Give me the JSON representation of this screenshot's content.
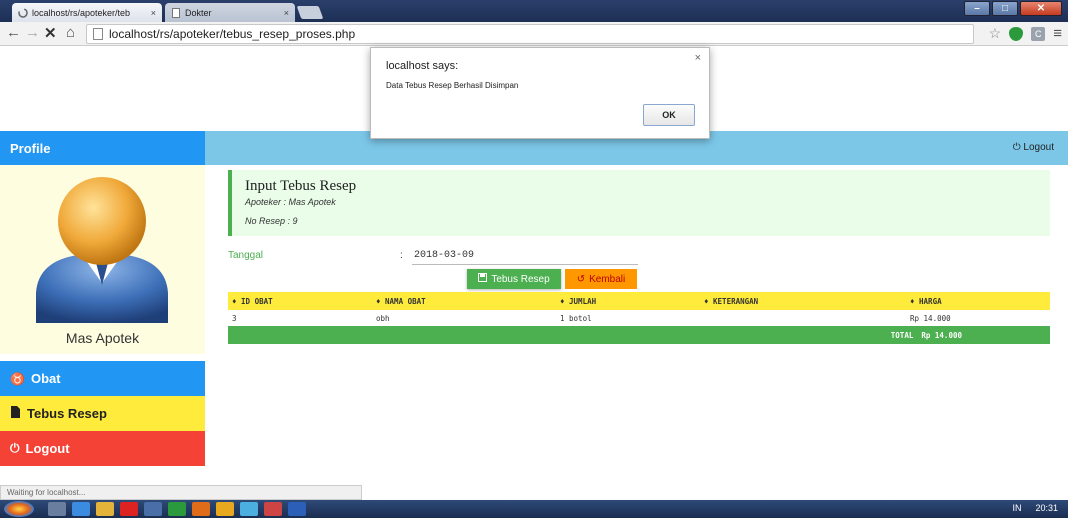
{
  "browser": {
    "tabs": [
      {
        "label": "localhost/rs/apoteker/teb",
        "close": "×"
      },
      {
        "label": "Dokter",
        "close": "×"
      }
    ],
    "url": "localhost/rs/apoteker/tebus_resep_proses.php",
    "status": "Waiting for localhost..."
  },
  "dialog": {
    "title": "localhost says:",
    "message": "Data Tebus Resep Berhasil Disimpan",
    "ok_label": "OK",
    "close": "×"
  },
  "sidebar": {
    "header": "Profile",
    "user_name": "Mas Apotek",
    "items": [
      {
        "label": "Obat",
        "icon": "pill-icon"
      },
      {
        "label": "Tebus Resep",
        "icon": "file-icon"
      },
      {
        "label": "Logout",
        "icon": "power-icon"
      }
    ]
  },
  "topnav": {
    "logout_label": "Logout"
  },
  "panel": {
    "title": "Input Tebus Resep",
    "apoteker": "Apoteker : Mas Apotek",
    "no_resep": "No Resep : 9"
  },
  "form": {
    "tanggal_label": "Tanggal",
    "colon": ":",
    "tanggal_value": "2018-03-09"
  },
  "buttons": {
    "tebus": "Tebus Resep",
    "kembali": "Kembali"
  },
  "table": {
    "headers": [
      "ID OBAT",
      "NAMA OBAT",
      "JUMLAH",
      "KETERANGAN",
      "HARGA"
    ],
    "rows": [
      {
        "id": "3",
        "nama": "obh",
        "jumlah": "1 botol",
        "keterangan": "",
        "harga": "Rp 14.000"
      }
    ],
    "total_label": "TOTAL",
    "total_value": "Rp 14.000"
  },
  "taskbar": {
    "lang": "IN",
    "time": "20:31"
  },
  "colors": {
    "blue": "#2196f3",
    "yellow": "#ffeb3b",
    "red": "#f44336",
    "green": "#4caf50",
    "orange": "#ff9800",
    "topnav": "#7cc7e8"
  }
}
